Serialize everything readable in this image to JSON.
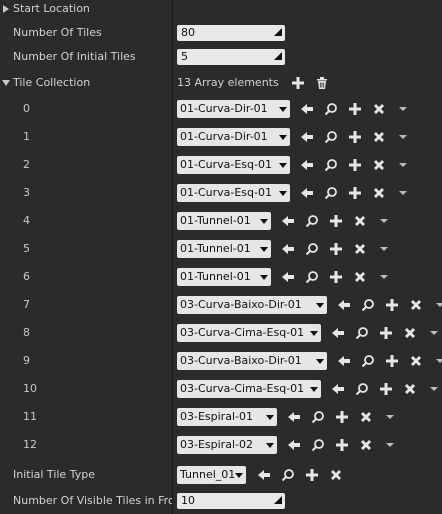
{
  "start_location": {
    "label": "Start Location"
  },
  "number_of_tiles": {
    "label": "Number Of Tiles",
    "value": "80"
  },
  "number_of_initial_tiles": {
    "label": "Number Of Initial Tiles",
    "value": "5"
  },
  "tile_collection": {
    "label": "Tile Collection",
    "count_text": "13 Array elements",
    "elements": [
      {
        "index": "0",
        "value": "01-Curva-Dir-01"
      },
      {
        "index": "1",
        "value": "01-Curva-Dir-01"
      },
      {
        "index": "2",
        "value": "01-Curva-Esq-01"
      },
      {
        "index": "3",
        "value": "01-Curva-Esq-01"
      },
      {
        "index": "4",
        "value": "01-Tunnel-01"
      },
      {
        "index": "5",
        "value": "01-Tunnel-01"
      },
      {
        "index": "6",
        "value": "01-Tunnel-01"
      },
      {
        "index": "7",
        "value": "03-Curva-Baixo-Dir-01"
      },
      {
        "index": "8",
        "value": "03-Curva-Cima-Esq-01"
      },
      {
        "index": "9",
        "value": "03-Curva-Baixo-Dir-01"
      },
      {
        "index": "10",
        "value": "03-Curva-Cima-Esq-01"
      },
      {
        "index": "11",
        "value": "03-Espiral-01"
      },
      {
        "index": "12",
        "value": "03-Espiral-02"
      }
    ]
  },
  "initial_tile_type": {
    "label": "Initial Tile Type",
    "value": "Tunnel_01"
  },
  "number_of_visible_tiles": {
    "label": "Number Of Visible Tiles in Fron",
    "value": "10"
  }
}
